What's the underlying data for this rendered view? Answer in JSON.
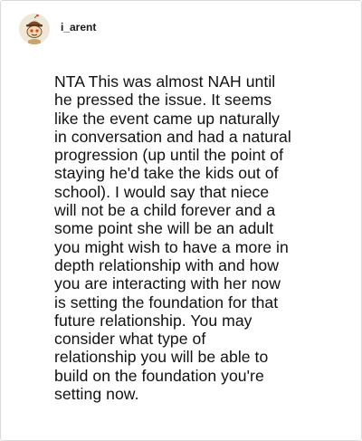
{
  "post": {
    "username": "i_arent",
    "avatar_icon": "snoo-avatar-icon",
    "comment_text": "NTA This was almost NAH until\nhe pressed the issue. It seems\nlike the event came up naturally\nin conversation and had a natural\nprogression (up until the point of\nstaying he'd take the kids out of\nschool). I would say that niece\nwill not be a child forever and a\nsome point she will be an adult\nyou might wish to have a more in\ndepth relationship with and how\nyou are interacting with her now\nis setting the foundation for that\nfuture relationship. You may\nconsider what type of\nrelationship you will be able to\nbuild on the foundation you're\nsetting now."
  },
  "colors": {
    "border": "#d9d9d9",
    "text": "#111111",
    "avatar_bg": "#efe8d6"
  }
}
